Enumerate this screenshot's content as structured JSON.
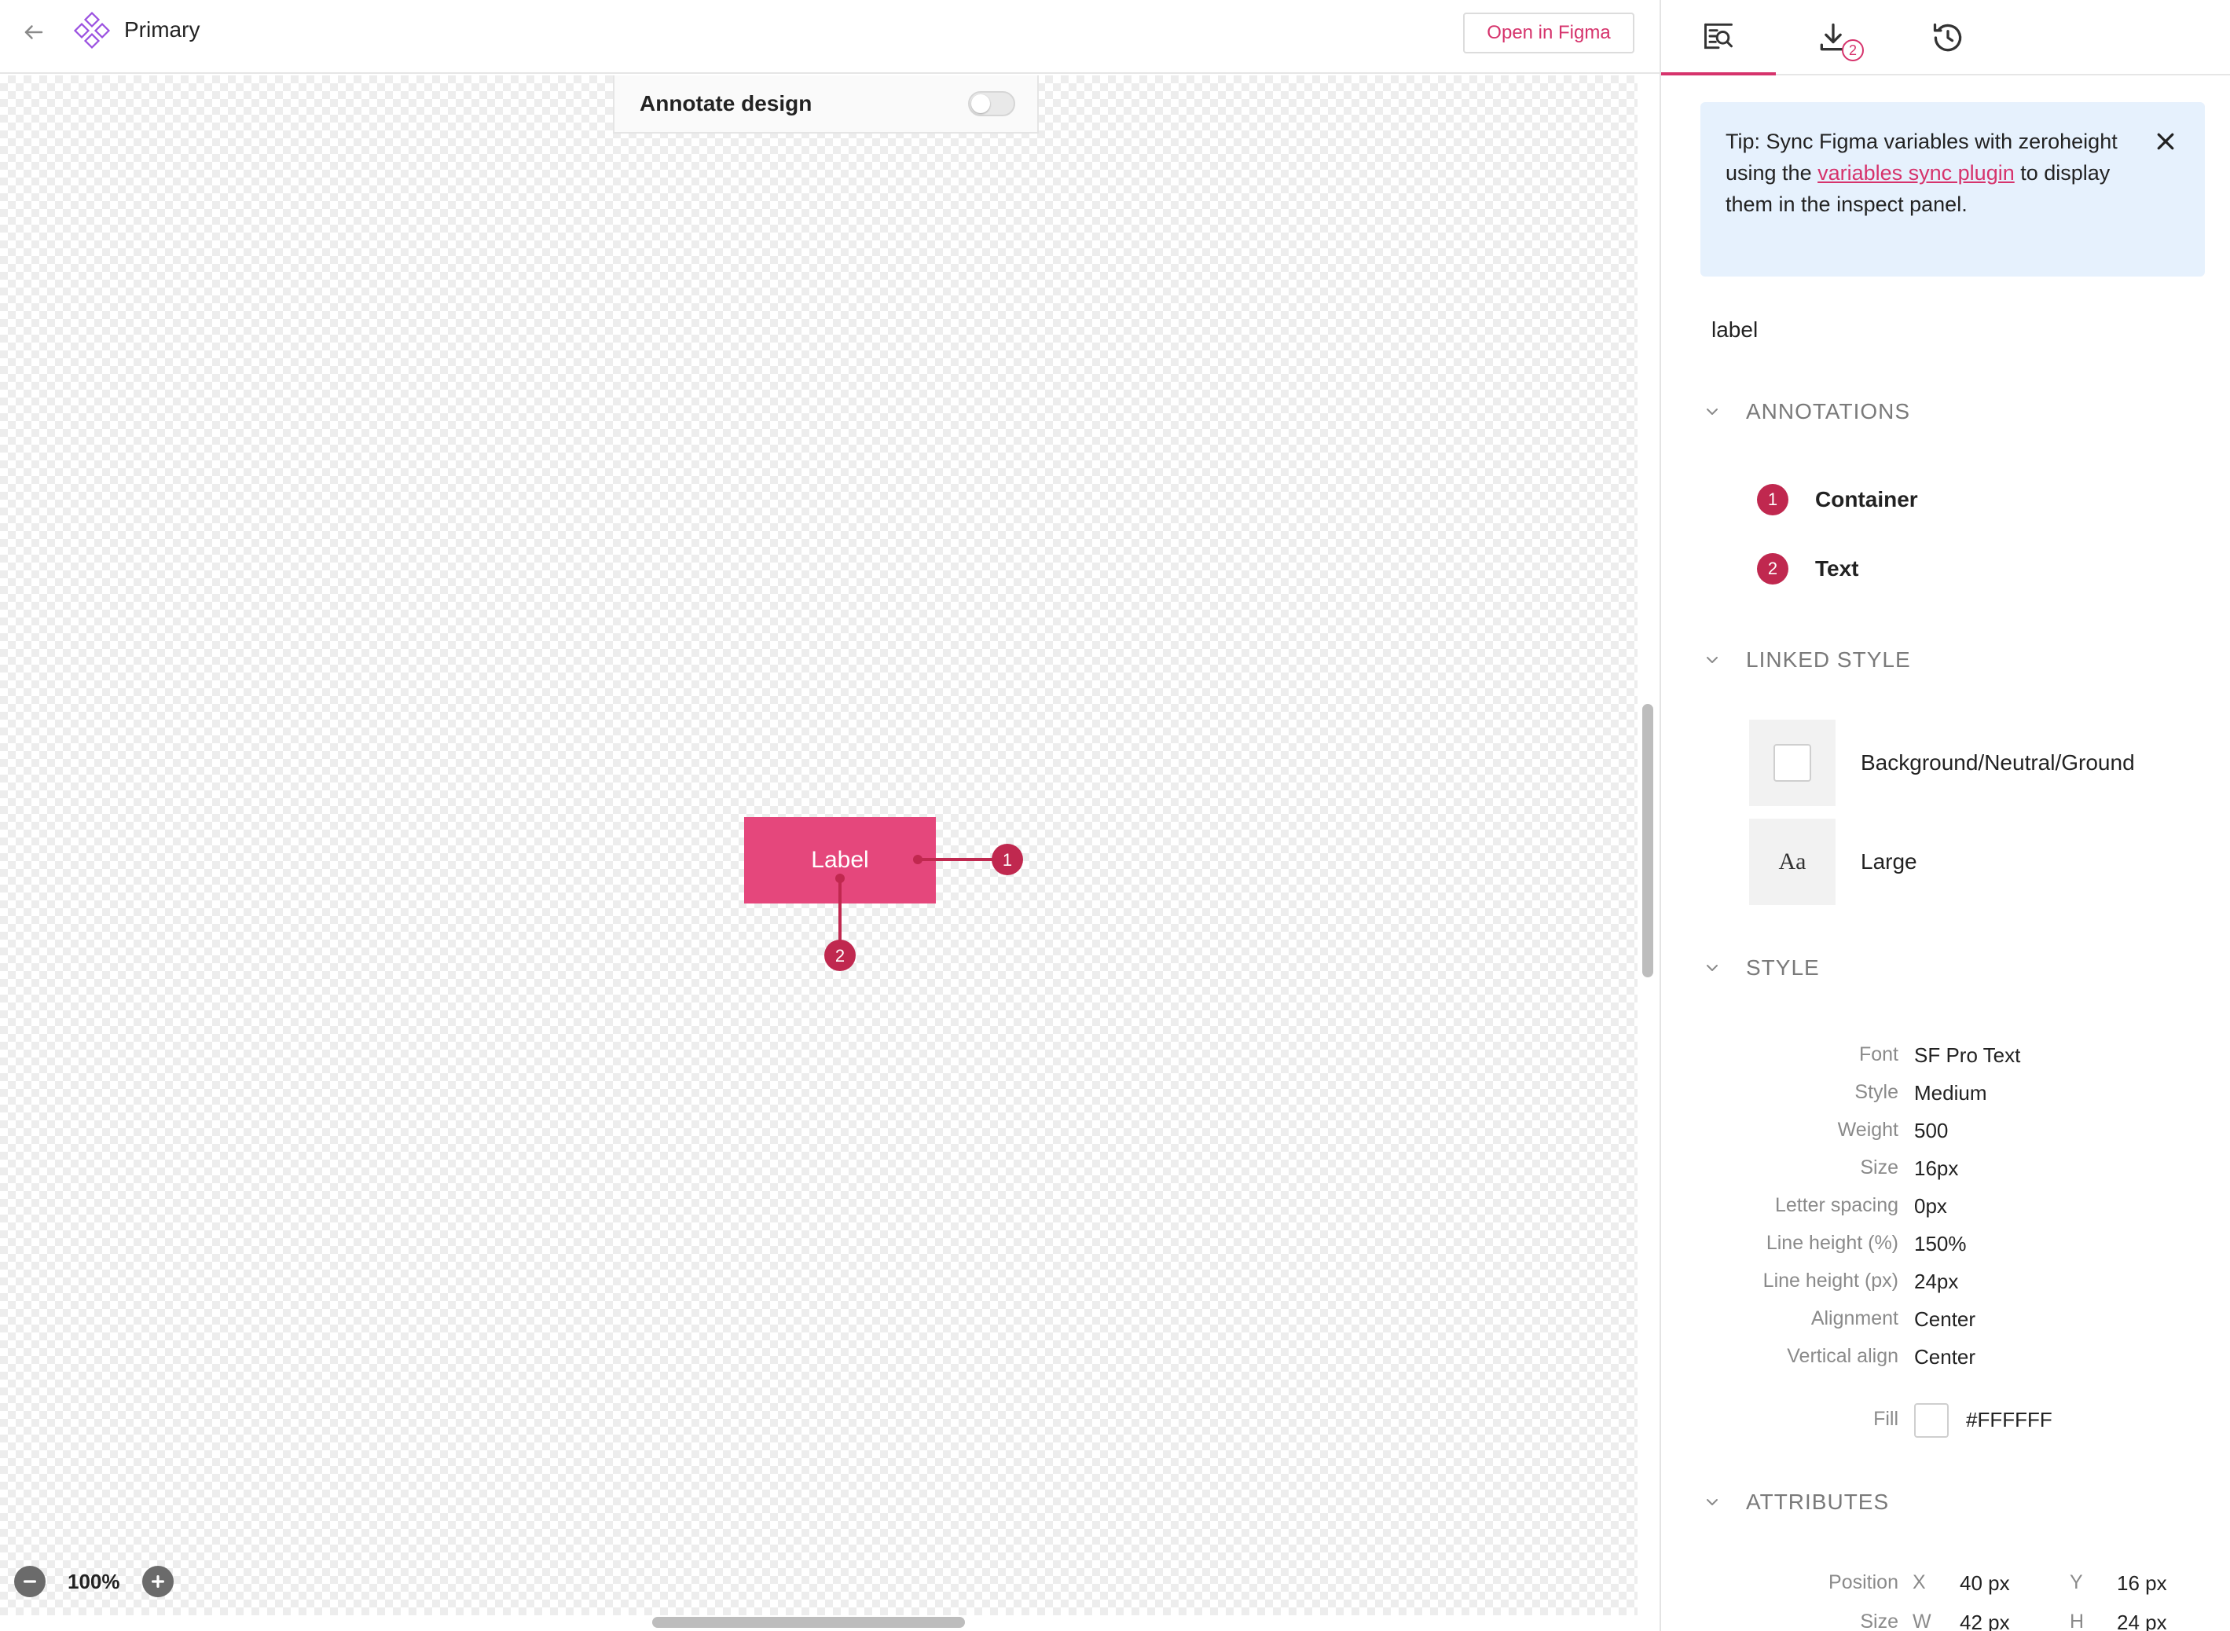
{
  "header": {
    "title": "Primary",
    "open_figma_label": "Open in Figma"
  },
  "annotate": {
    "label": "Annotate design",
    "enabled": false
  },
  "canvas": {
    "component_label": "Label",
    "markers": [
      "1",
      "2"
    ]
  },
  "zoom": {
    "level": "100%"
  },
  "tabs": {
    "items": [
      "inspect-icon",
      "download-icon",
      "history-icon"
    ],
    "download_badge": "2"
  },
  "tip": {
    "text_before": "Tip: Sync Figma variables with zeroheight using the ",
    "link_text": "variables sync plugin",
    "text_after": " to display them in the inspect panel."
  },
  "layer_name": "label",
  "sections": {
    "annotations": "ANNOTATIONS",
    "linked_style": "LINKED STYLE",
    "style": "STYLE",
    "attributes": "ATTRIBUTES"
  },
  "annotations": [
    {
      "number": "1",
      "label": "Container"
    },
    {
      "number": "2",
      "label": "Text"
    }
  ],
  "linked_styles": [
    {
      "icon": "color-swatch-icon",
      "label": "Background/Neutral/Ground"
    },
    {
      "icon": "Aa",
      "label": "Large"
    }
  ],
  "style_props": [
    {
      "label": "Font",
      "value": "SF Pro Text"
    },
    {
      "label": "Style",
      "value": "Medium"
    },
    {
      "label": "Weight",
      "value": "500"
    },
    {
      "label": "Size",
      "value": "16px"
    },
    {
      "label": "Letter spacing",
      "value": "0px"
    },
    {
      "label": "Line height (%)",
      "value": "150%"
    },
    {
      "label": "Line height (px)",
      "value": "24px"
    },
    {
      "label": "Alignment",
      "value": "Center"
    },
    {
      "label": "Vertical align",
      "value": "Center"
    }
  ],
  "fill": {
    "label": "Fill",
    "value": "#FFFFFF"
  },
  "attributes": {
    "position_label": "Position",
    "x_label": "X",
    "x_value": "40 px",
    "y_label": "Y",
    "y_value": "16 px",
    "size_label": "Size",
    "w_label": "W",
    "w_value": "42 px",
    "h_label": "H",
    "h_value": "24 px"
  },
  "colors": {
    "accent": "#d6336c",
    "component": "#e5477c",
    "marker": "#c0284f",
    "tip_bg": "#e6f1fd"
  }
}
